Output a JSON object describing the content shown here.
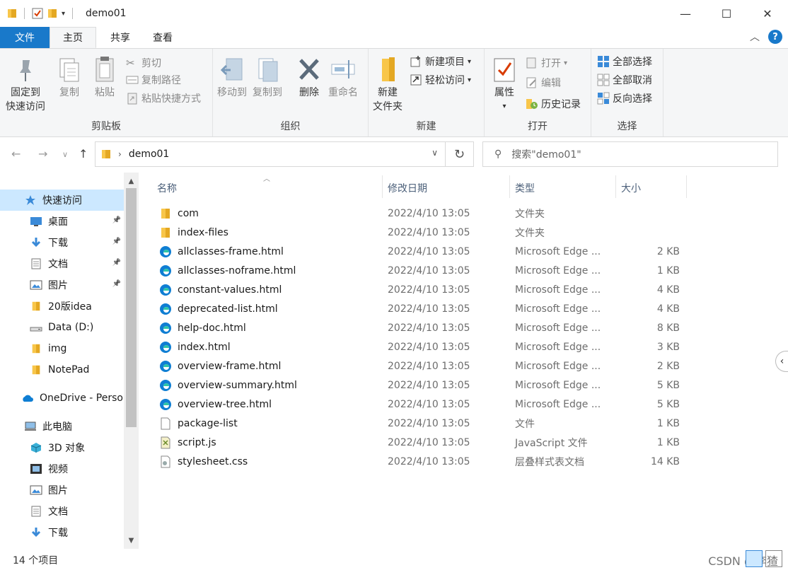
{
  "window": {
    "title": "demo01",
    "minimize": "—",
    "maximize": "☐",
    "close": "✕"
  },
  "ribbon_tabs": [
    "文件",
    "主页",
    "共享",
    "查看"
  ],
  "ribbon": {
    "clipboard": {
      "pin": "固定到",
      "pin2": "快速访问",
      "copy": "复制",
      "paste": "粘贴",
      "cut": "剪切",
      "copy_path": "复制路径",
      "paste_shortcut": "粘贴快捷方式",
      "label": "剪贴板"
    },
    "organize": {
      "move_to": "移动到",
      "copy_to": "复制到",
      "delete": "删除",
      "rename": "重命名",
      "label": "组织"
    },
    "new": {
      "new_folder": "新建",
      "new_folder2": "文件夹",
      "new_item": "新建项目",
      "easy_access": "轻松访问",
      "label": "新建"
    },
    "open": {
      "properties": "属性",
      "open": "打开",
      "edit": "编辑",
      "history": "历史记录",
      "label": "打开"
    },
    "select": {
      "select_all": "全部选择",
      "select_none": "全部取消",
      "invert": "反向选择",
      "label": "选择"
    }
  },
  "address": {
    "path": "demo01",
    "search_placeholder": "搜索\"demo01\""
  },
  "nav": [
    {
      "label": "快速访问",
      "icon": "star-icon",
      "selected": true,
      "indent": 34,
      "pinned": false
    },
    {
      "label": "桌面",
      "icon": "desktop-icon",
      "indent": 42,
      "pinned": true
    },
    {
      "label": "下载",
      "icon": "download-icon",
      "indent": 42,
      "pinned": true
    },
    {
      "label": "文档",
      "icon": "document-icon",
      "indent": 42,
      "pinned": true
    },
    {
      "label": "图片",
      "icon": "picture-icon",
      "indent": 42,
      "pinned": true
    },
    {
      "label": "20版idea",
      "icon": "folder-icon",
      "indent": 42,
      "pinned": false
    },
    {
      "label": "Data (D:)",
      "icon": "drive-icon",
      "indent": 42,
      "pinned": false
    },
    {
      "label": "img",
      "icon": "folder-icon",
      "indent": 42,
      "pinned": false
    },
    {
      "label": "NotePad",
      "icon": "folder-icon",
      "indent": 42,
      "pinned": false
    },
    {
      "label": "OneDrive - Perso",
      "icon": "cloud-icon",
      "indent": 30,
      "pinned": false,
      "gap": true
    },
    {
      "label": "此电脑",
      "icon": "computer-icon",
      "indent": 34,
      "pinned": false,
      "gap": true
    },
    {
      "label": "3D 对象",
      "icon": "cube-icon",
      "indent": 42,
      "pinned": false
    },
    {
      "label": "视频",
      "icon": "video-icon",
      "indent": 42,
      "pinned": false
    },
    {
      "label": "图片",
      "icon": "picture-icon",
      "indent": 42,
      "pinned": false
    },
    {
      "label": "文档",
      "icon": "document-icon",
      "indent": 42,
      "pinned": false
    },
    {
      "label": "下载",
      "icon": "download-icon",
      "indent": 42,
      "pinned": false
    }
  ],
  "columns": {
    "name": "名称",
    "date": "修改日期",
    "type": "类型",
    "size": "大小"
  },
  "files": [
    {
      "name": "com",
      "date": "2022/4/10 13:05",
      "type": "文件夹",
      "size": "",
      "icon": "folder-icon"
    },
    {
      "name": "index-files",
      "date": "2022/4/10 13:05",
      "type": "文件夹",
      "size": "",
      "icon": "folder-icon"
    },
    {
      "name": "allclasses-frame.html",
      "date": "2022/4/10 13:05",
      "type": "Microsoft Edge ...",
      "size": "2 KB",
      "icon": "edge-icon"
    },
    {
      "name": "allclasses-noframe.html",
      "date": "2022/4/10 13:05",
      "type": "Microsoft Edge ...",
      "size": "1 KB",
      "icon": "edge-icon"
    },
    {
      "name": "constant-values.html",
      "date": "2022/4/10 13:05",
      "type": "Microsoft Edge ...",
      "size": "4 KB",
      "icon": "edge-icon"
    },
    {
      "name": "deprecated-list.html",
      "date": "2022/4/10 13:05",
      "type": "Microsoft Edge ...",
      "size": "4 KB",
      "icon": "edge-icon"
    },
    {
      "name": "help-doc.html",
      "date": "2022/4/10 13:05",
      "type": "Microsoft Edge ...",
      "size": "8 KB",
      "icon": "edge-icon"
    },
    {
      "name": "index.html",
      "date": "2022/4/10 13:05",
      "type": "Microsoft Edge ...",
      "size": "3 KB",
      "icon": "edge-icon"
    },
    {
      "name": "overview-frame.html",
      "date": "2022/4/10 13:05",
      "type": "Microsoft Edge ...",
      "size": "2 KB",
      "icon": "edge-icon"
    },
    {
      "name": "overview-summary.html",
      "date": "2022/4/10 13:05",
      "type": "Microsoft Edge ...",
      "size": "5 KB",
      "icon": "edge-icon"
    },
    {
      "name": "overview-tree.html",
      "date": "2022/4/10 13:05",
      "type": "Microsoft Edge ...",
      "size": "5 KB",
      "icon": "edge-icon"
    },
    {
      "name": "package-list",
      "date": "2022/4/10 13:05",
      "type": "文件",
      "size": "1 KB",
      "icon": "file-icon"
    },
    {
      "name": "script.js",
      "date": "2022/4/10 13:05",
      "type": "JavaScript 文件",
      "size": "1 KB",
      "icon": "script-icon"
    },
    {
      "name": "stylesheet.css",
      "date": "2022/4/10 13:05",
      "type": "层叠样式表文档",
      "size": "14 KB",
      "icon": "css-icon"
    }
  ],
  "status": {
    "count": "14 个项目",
    "watermark": "CSDN @李猹"
  },
  "colors": {
    "accent": "#1979ca",
    "folder": "#f8c64a",
    "edge": "#0f7ed3",
    "selected": "#cce8ff"
  }
}
